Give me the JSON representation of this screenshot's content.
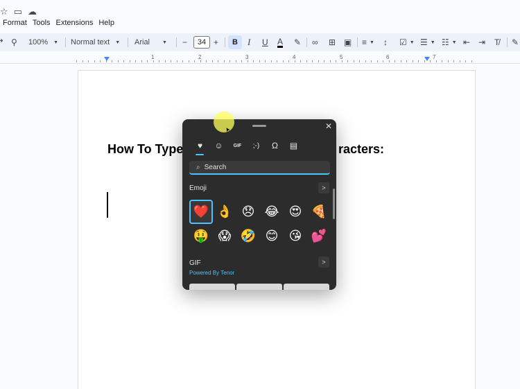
{
  "title_icons": [
    "star-icon",
    "folder-icon",
    "cloud-icon"
  ],
  "menu": [
    "Format",
    "Tools",
    "Extensions",
    "Help"
  ],
  "toolbar": {
    "zoom": "100%",
    "style": "Normal text",
    "font": "Arial",
    "font_size": "34",
    "bold": "B",
    "italic": "I",
    "underline": "U",
    "text_color": "A",
    "minus": "−",
    "plus": "+"
  },
  "ruler_numbers": [
    "1",
    "2",
    "3",
    "4",
    "5",
    "6",
    "7"
  ],
  "document": {
    "heading_start": "How To Type",
    "heading_end": "racters:"
  },
  "emoji_panel": {
    "close": "✕",
    "tabs": [
      "heart-icon",
      "smiley-icon",
      "gif-icon",
      "kaomoji-icon",
      "symbols-icon",
      "clipboard-icon"
    ],
    "tab_glyphs": [
      "♥",
      "☺",
      "GIF",
      ";-)",
      "Ω",
      "▤"
    ],
    "search_placeholder": "Search",
    "emoji_title": "Emoji",
    "gif_title": "GIF",
    "powered_by": "Powered By Tenor",
    "arrow": ">",
    "emojis": [
      "❤️",
      "👌",
      "😞",
      "😂",
      "😍",
      "🍕",
      "🤑",
      "😱",
      "🤣",
      "😊",
      "😘",
      "💕"
    ]
  },
  "colors": {
    "accent": "#4cc2ff",
    "panel_bg": "#2c2c2c",
    "toolbar_bg": "#edf2fa"
  }
}
